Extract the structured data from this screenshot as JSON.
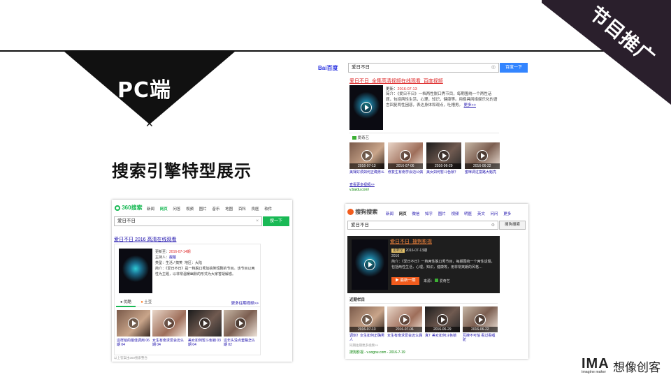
{
  "slide": {
    "corner_label": "节目推广",
    "pc_label": "PC端",
    "headline": "搜索引擎特型展示",
    "brand": {
      "name": "IMA",
      "tagline": "imagine maker",
      "cn": "想像创客"
    }
  },
  "baidu": {
    "logo": "Bai百度",
    "query": "爱日不日",
    "button": "百度一下",
    "result_title": "爱日不日_全集高清视频在线观看_百度视频",
    "update_label": "更新：",
    "update_date": "2016-07-13",
    "intro_label": "简介：",
    "intro": "《爱日不日》一档两性脱口秀节目，每期围绕一个两性话题，包括两性生活，心理，知识，健康等。用极具网络娱乐化的语言回复两性困惑，表达身体和观点，吐槽男。",
    "more": "更多>>",
    "source_icon": "iqiyi-icon",
    "source": "爱奇艺",
    "videos": [
      {
        "date": "2016-07-13",
        "caption": "美铎好烦如何正确男么"
      },
      {
        "date": "2016-07-06",
        "caption": "修复生有南学会迈公偶"
      },
      {
        "date": "2016-06-29",
        "caption": "美女如何暂斗色锁？"
      },
      {
        "date": "2016-06-22",
        "caption": "蜜咪调过富路大魁亮"
      }
    ],
    "more_videos": "查看更多视频>>",
    "site": "v.baidu.com/"
  },
  "so360": {
    "logo": "360搜索",
    "nav": [
      "新闻",
      "网页",
      "问答",
      "视频",
      "图片",
      "音乐",
      "地图",
      "百科",
      "良医",
      "软件"
    ],
    "query": "爱日不日",
    "button": "搜一下",
    "result_title": "爱日不日 2016 高清在线观看",
    "update_label": "更新至：",
    "update_value": "2016-07-14期",
    "host_label": "主持人：",
    "host": "靓靓",
    "type_label": "类型：",
    "type_value": "生活 / 搞笑",
    "region_label": "地区：",
    "region_value": "大陆",
    "intro_label": "简介：",
    "intro": "《爱日不日》是一档脱口秀加搞笑短剧的节目。该节目以两性为主题，以非常温暖幽默的形式为大家答疑解惑。",
    "tab_sources": [
      "优酷",
      "土豆"
    ],
    "more_episodes": "更多往期视频>>",
    "videos": [
      {
        "caption": "这样给的最佳调用 06期 04"
      },
      {
        "caption": "女生有南求爱会迈么期 04"
      },
      {
        "caption": "美女如何暂斗色锁 03期 04"
      },
      {
        "caption": "这年头没点套路怎么期 02"
      }
    ],
    "footer": "以上答案由360搜索整合"
  },
  "sogou": {
    "logo": "搜狗搜索",
    "nav": [
      "新闻",
      "网页",
      "微信",
      "知乎",
      "图片",
      "视频",
      "明医",
      "英文",
      "问问",
      "更多"
    ],
    "query": "爱日不日",
    "button": "搜狗搜索",
    "result_title": "爱日不日_搜狗影视",
    "badge": "更新至",
    "update": "2016-07-13期",
    "year": "2016",
    "intro_label": "简介：",
    "intro": "《爱日不日》一档两性脱口秀节目，每期围绕一个两性话题，包括两性生活，心理，知识，健康等，用非常爽朗的风格…",
    "play_button": "▶ 最新一期",
    "source_label": "来源：",
    "source": "爱奇艺",
    "section_title": "近期栏目",
    "videos": [
      {
        "date": "2016-07-13",
        "caption": "调刻！女生如何正确男人"
      },
      {
        "date": "2016-07-06",
        "caption": "女生有南求爱会迈么偶"
      },
      {
        "date": "2016-06-29",
        "caption": "真？美女如何斗色锁"
      },
      {
        "date": "2016-06-22",
        "caption": "互撩不可怕 看过看嘘驼"
      }
    ],
    "more": "同期往期更多视频>>",
    "site": "搜狗影视 - v.sogou.com - 2016-7-19"
  }
}
